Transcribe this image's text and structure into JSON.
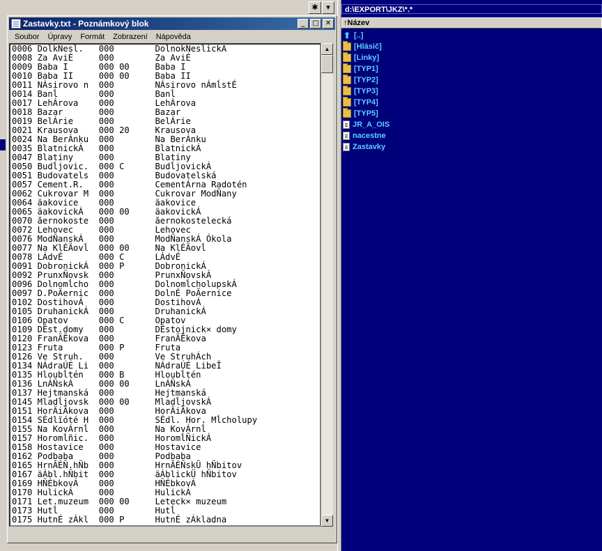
{
  "notepad": {
    "title": "Zastavky.txt - Poznámkový blok",
    "menu": [
      "Soubor",
      "Úpravy",
      "Formát",
      "Zobrazení",
      "Nápověda"
    ],
    "lines": [
      "0006 DolkÑesl.   000        DolnokÑeslickÁ",
      "0008 Za AviÉ     000        Za AviÉ",
      "0009 Baba I      000 00     Baba I",
      "0010 Baba II     000 00     Baba II",
      "0011 NÁsirovo n  000        NÁsirovo nÁmĺstÉ",
      "0014 Banĺ        000        Banĺ",
      "0017 LehÁrova    000        LehÁrova",
      "0018 Bazar       000        Bazar",
      "0019 BelÁrie     000        BelÁrie",
      "0021 Krausova    000 20     Krausova",
      "0024 Na BerÁnku  000        Na BerÁnku",
      "0035 BlatnickÁ   000        BlatnickÁ",
      "0047 Blatiny     000        Blatiny",
      "0050 Budĺjovic.  000 C      BudĺjovickÁ",
      "0051 Budovatels  000        Budovatelská",
      "0057 Cement.R.   000        CementÁrna Radotén",
      "0062 Cukrovar M  000        Cukrovar ModÑany",
      "0064 äakovice    000        äakovice",
      "0065 äakovickÁ   000 00     äakovickÁ",
      "0070 ăernokoste  000        ăernokostelecká",
      "0072 Lehovec     000        Lehovec",
      "0076 ModÑanskÁ   000        ModÑanskÁ Ókola",
      "0077 Na KlÉÄovĺ  000 00     Na KlÉÄovĺ",
      "0078 LÁdvÉ       000 C      LÁdvÉ",
      "0091 DobronickÁ  000 P      DobronickÁ",
      "0092 PrunxÑovsk  000        PrunxÑovskÁ",
      "0096 Dolnomĺcho  000        DolnomĺcholupskÁ",
      "0097 D.PoÄernic  000        DolnÉ PoÄernice",
      "0102 DostihovÁ   000        DostihovÁ",
      "0105 DruhanickÁ  000        DruhanickÁ",
      "0106 Opatov      000 C      Opatov",
      "0109 DĚst.domy   000        DĚstojnick× domy",
      "0120 FranÄĔkova  000        FranÄĔkova",
      "0123 Fruta       000 P      Fruta",
      "0126 Ve Struh.   000        Ve StruhÁch",
      "0134 NÁdraÚÉ Li  000        NÁdraÚÉ LibeÎ",
      "0135 Hloubĺtén   000 B      Hloubĺtén",
      "0136 LnÁÑskÁ     000 00     LnÁÑskÁ",
      "0137 Hejtmanská  000        Hejtmanská",
      "0145 Mladĺjovsk  000 00     MladĺjovskÁ",
      "0151 HorÄiÄkova  000        HorÄiÄkova",
      "0154 SÉdlïóté H  000        SÉdl. Hor. Mĺcholupy",
      "0155 Na KovÁrnĺ  000        Na KovÁrnĺ",
      "0157 Horomĺñic.  000        HoromĺÑickÁ",
      "0158 Hostavice   000        Hostavice",
      "0162 Podbaba     000        Podbaba",
      "0165 HrnĂÉÑ.hÑb  000        HrnĂÉÑskÜ hÑbitov",
      "0167 äÁbl.hÑbit  000        äÁblickÜ hÑbitov",
      "0169 HÑÉbkovÁ    000        HÑÉbkovÁ",
      "0170 HulickÁ     000        HulickÁ",
      "0171 Let.muzeum  000 00     Leteck× muzeum",
      "0173 Hutĺ        000        Hutĺ",
      "0175 HutnÉ zÁkl  000 P      HutnÉ zÁkladna"
    ]
  },
  "panel": {
    "path": "d:\\EXPORT\\JKZ\\*.*",
    "column": "Název",
    "items": [
      {
        "name": "[..]",
        "type": "up"
      },
      {
        "name": "[Hlásič]",
        "type": "folder"
      },
      {
        "name": "[Linky]",
        "type": "folder"
      },
      {
        "name": "[TYP1]",
        "type": "folder"
      },
      {
        "name": "[TYP2]",
        "type": "folder"
      },
      {
        "name": "[TYP3]",
        "type": "folder"
      },
      {
        "name": "[TYP4]",
        "type": "folder"
      },
      {
        "name": "[TYP5]",
        "type": "folder"
      },
      {
        "name": "JR_A_OIS",
        "type": "file"
      },
      {
        "name": "nacestne",
        "type": "file"
      },
      {
        "name": "Zastavky",
        "type": "file"
      }
    ]
  },
  "colors": {
    "panel_bg": "#00007a",
    "panel_text": "#5ad0ff",
    "title_active": "#0a246a"
  }
}
